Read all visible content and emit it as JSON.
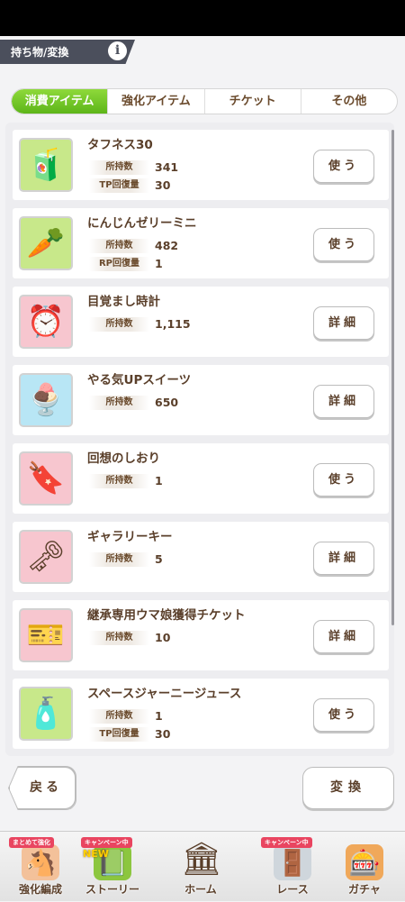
{
  "header": {
    "title": "持ち物/変換",
    "info_icon": "info-icon"
  },
  "tabs": [
    {
      "label": "消費アイテム",
      "active": true
    },
    {
      "label": "強化アイテム",
      "active": false
    },
    {
      "label": "チケット",
      "active": false
    },
    {
      "label": "その他",
      "active": false
    }
  ],
  "items": [
    {
      "name": "タフネス30",
      "icon": "tp-drink-icon",
      "icon_bg": "#c8e88a",
      "stats": [
        {
          "label": "所持数",
          "value": "341"
        },
        {
          "label": "TP回復量",
          "value": "30"
        }
      ],
      "action": "使う"
    },
    {
      "name": "にんじんゼリーミニ",
      "icon": "carrot-jelly-icon",
      "icon_bg": "#c8e88a",
      "stats": [
        {
          "label": "所持数",
          "value": "482"
        },
        {
          "label": "RP回復量",
          "value": "1"
        }
      ],
      "action": "使う"
    },
    {
      "name": "目覚まし時計",
      "icon": "alarm-clock-icon",
      "icon_bg": "#f7c6cf",
      "stats": [
        {
          "label": "所持数",
          "value": "1,115"
        }
      ],
      "action": "詳細"
    },
    {
      "name": "やる気UPスイーツ",
      "icon": "parfait-icon",
      "icon_bg": "#b8e6f5",
      "stats": [
        {
          "label": "所持数",
          "value": "650"
        }
      ],
      "action": "詳細"
    },
    {
      "name": "回想のしおり",
      "icon": "bookmark-icon",
      "icon_bg": "#f7c6cf",
      "stats": [
        {
          "label": "所持数",
          "value": "1"
        }
      ],
      "action": "使う"
    },
    {
      "name": "ギャラリーキー",
      "icon": "key-icon",
      "icon_bg": "#f7c6cf",
      "stats": [
        {
          "label": "所持数",
          "value": "5"
        }
      ],
      "action": "詳細"
    },
    {
      "name": "継承専用ウマ娘獲得チケット",
      "icon": "ticket-icon",
      "icon_bg": "#f7c6cf",
      "stats": [
        {
          "label": "所持数",
          "value": "10"
        }
      ],
      "action": "詳細"
    },
    {
      "name": "スペースジャーニージュース",
      "icon": "juice-bottle-icon",
      "icon_bg": "#c8e88a",
      "stats": [
        {
          "label": "所持数",
          "value": "1"
        },
        {
          "label": "TP回復量",
          "value": "30"
        }
      ],
      "action": "使う"
    }
  ],
  "buttons": {
    "back": "戻る",
    "convert": "変換"
  },
  "nav": [
    {
      "label": "強化編成",
      "badge": "まとめて強化",
      "icon": "character-icon"
    },
    {
      "label": "ストーリー",
      "badge": "キャンペーン中",
      "new": "NEW",
      "icon": "book-icon"
    },
    {
      "label": "ホーム",
      "icon": "home-building-icon"
    },
    {
      "label": "レース",
      "badge": "キャンペーン中",
      "icon": "race-gate-icon"
    },
    {
      "label": "ガチャ",
      "icon": "gacha-icon"
    }
  ]
}
